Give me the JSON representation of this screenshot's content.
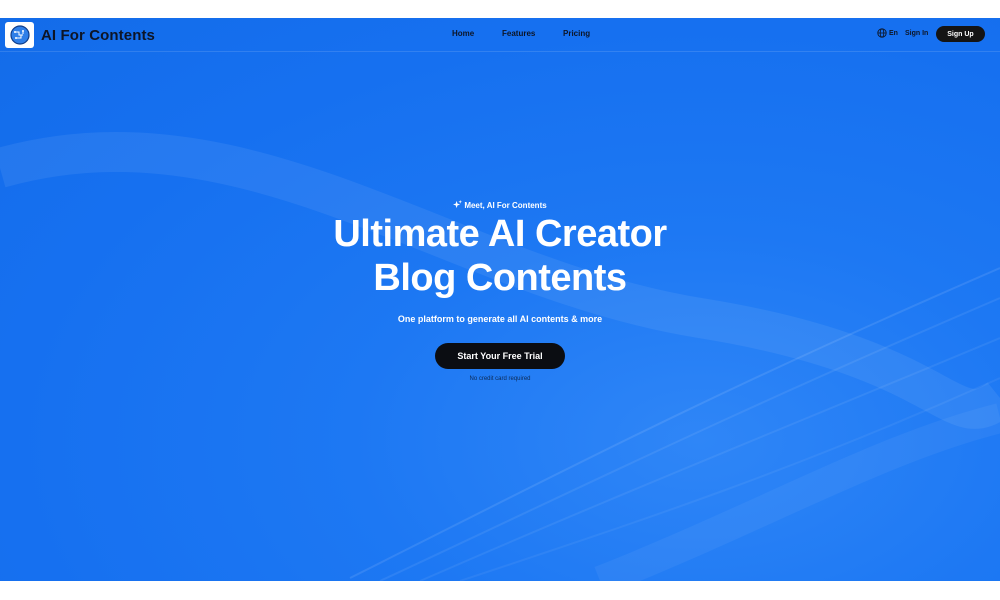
{
  "brand": {
    "name": "AI For Contents",
    "logo_icon": "brain-chip-icon"
  },
  "nav": {
    "items": [
      {
        "label": "Home"
      },
      {
        "label": "Features"
      },
      {
        "label": "Pricing"
      }
    ],
    "language": {
      "icon": "globe-icon",
      "label": "En"
    },
    "signin_label": "Sign In",
    "signup_label": "Sign Up"
  },
  "hero": {
    "tagline_icon": "sparkle-icon",
    "tagline": "Meet, AI For Contents",
    "title_line1": "Ultimate AI Creator",
    "title_line2": "Blog Contents",
    "subtitle": "One platform to generate all AI contents & more",
    "cta_label": "Start Your Free Trial",
    "note": "No credit card required"
  },
  "colors": {
    "background": "#1670f0",
    "cta_bg": "#0b0d12",
    "nav_text": "#0d1526",
    "white": "#ffffff"
  }
}
